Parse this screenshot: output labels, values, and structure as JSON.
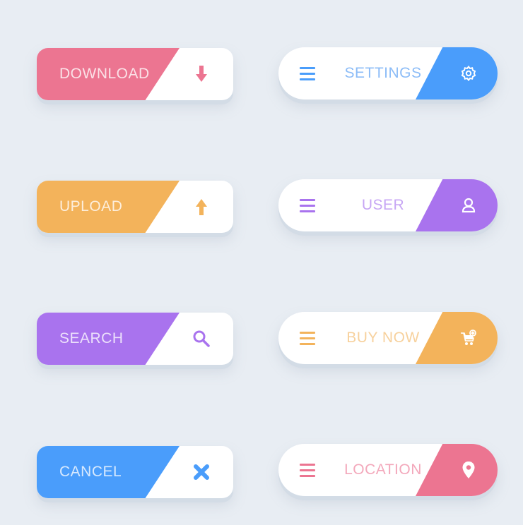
{
  "colors": {
    "pink": "#ec7591",
    "orange": "#f3b35b",
    "purple": "#a973ee",
    "blue": "#4a9dfb",
    "background": "#e8edf3"
  },
  "left_buttons": [
    {
      "label": "DOWNLOAD",
      "icon": "download-arrow-icon",
      "color": "#ec7591"
    },
    {
      "label": "UPLOAD",
      "icon": "upload-arrow-icon",
      "color": "#f3b35b"
    },
    {
      "label": "SEARCH",
      "icon": "search-icon",
      "color": "#a973ee"
    },
    {
      "label": "CANCEL",
      "icon": "close-icon",
      "color": "#4a9dfb"
    }
  ],
  "right_buttons": [
    {
      "label": "SETTINGS",
      "icon": "gear-icon",
      "color": "#4a9dfb"
    },
    {
      "label": "USER",
      "icon": "user-icon",
      "color": "#a973ee"
    },
    {
      "label": "BUY NOW",
      "icon": "cart-icon",
      "color": "#f3b35b"
    },
    {
      "label": "LOCATION",
      "icon": "location-pin-icon",
      "color": "#ec7591"
    }
  ]
}
